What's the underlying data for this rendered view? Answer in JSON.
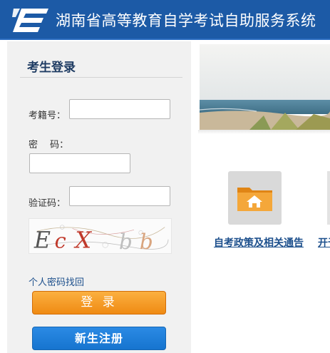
{
  "header": {
    "site_title": "湖南省高等教育自学考试自助服务系统",
    "background_color": "#1c5aa6",
    "logo_icon": "exam-logo-icon"
  },
  "login": {
    "title": "考生登录",
    "exam_id_label": "考籍号：",
    "exam_id_value": "",
    "password_label": "密　 码：",
    "password_value": "",
    "captcha_label": "验证码：",
    "captcha_value": "",
    "captcha_text": "EcXbb",
    "forgot_password_link": "个人密码找回",
    "login_button": "登 录",
    "register_button": "新生注册",
    "login_button_color": "#f39a1e",
    "register_button_color": "#1a7bd6"
  },
  "main": {
    "banner_icon": "beach-banner-image",
    "tiles": [
      {
        "icon": "home-folder-icon",
        "label": "自考政策及相关通告"
      },
      {
        "icon": "partial-tile-icon",
        "label": "开于"
      }
    ]
  }
}
